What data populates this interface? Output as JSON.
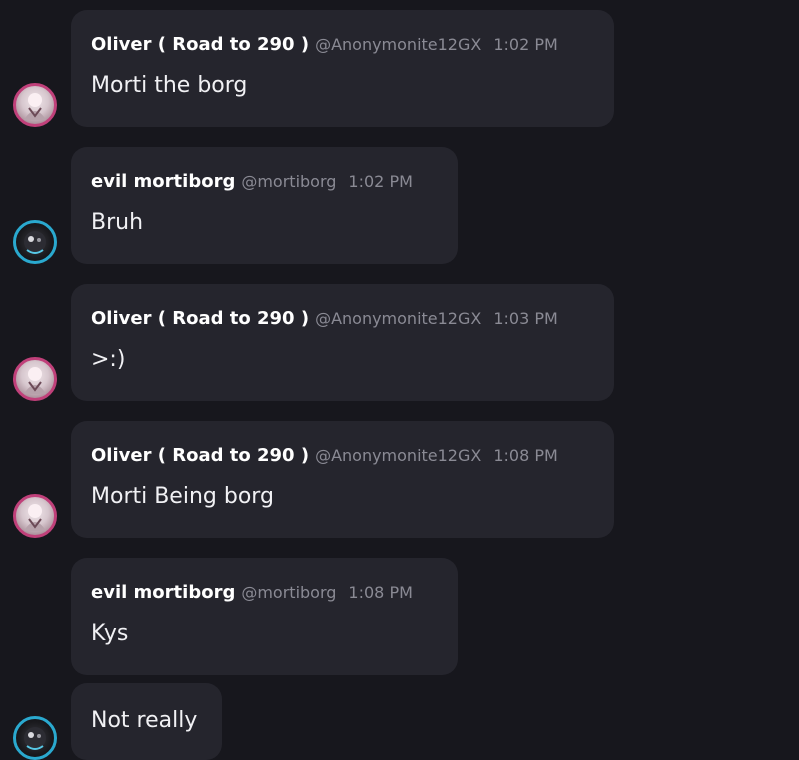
{
  "colors": {
    "background": "#17171d",
    "bubble": "#25252d",
    "username": "#ffffff",
    "meta": "#8a8a94",
    "text": "#f1f1f4",
    "oliver_ring": "#c0407a",
    "evil_ring": "#2aa9cf"
  },
  "messages": [
    {
      "author": "Oliver ( Road to 290 )",
      "handle": "@Anonymonite12GX",
      "time": "1:02 PM",
      "text": "Morti the borg",
      "avatar_icon": "oliver-avatar"
    },
    {
      "author": "evil mortiborg",
      "handle": "@mortiborg",
      "time": "1:02 PM",
      "text": "Bruh",
      "avatar_icon": "mortiborg-avatar"
    },
    {
      "author": "Oliver ( Road to 290 )",
      "handle": "@Anonymonite12GX",
      "time": "1:03 PM",
      "text": ">:)",
      "avatar_icon": "oliver-avatar"
    },
    {
      "author": "Oliver ( Road to 290 )",
      "handle": "@Anonymonite12GX",
      "time": "1:08 PM",
      "text": "Morti Being borg",
      "avatar_icon": "oliver-avatar"
    },
    {
      "author": "evil mortiborg",
      "handle": "@mortiborg",
      "time": "1:08 PM",
      "text": "Kys",
      "avatar_icon": "mortiborg-avatar"
    },
    {
      "text": "Not really",
      "avatar_icon": "mortiborg-avatar"
    }
  ]
}
